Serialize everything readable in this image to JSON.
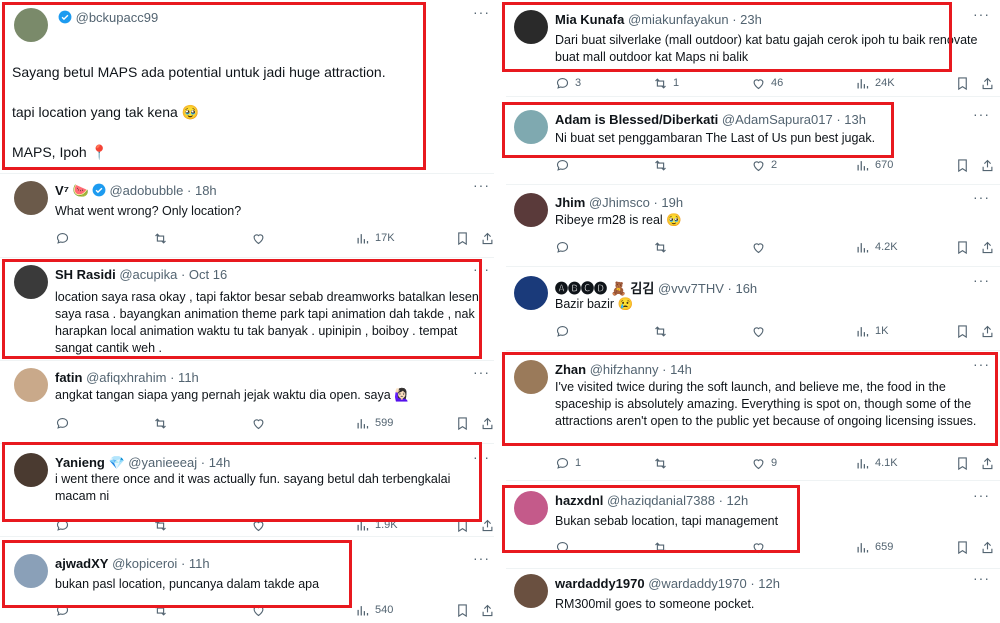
{
  "left": [
    {
      "name": "",
      "verified": true,
      "handle": "@bckupacc99",
      "time": "",
      "text": "Sayang betul MAPS ada potential untuk jadi huge attraction.\n\ntapi location yang tak kena 🥹\n\nMAPS, Ipoh 📍",
      "stats": {
        "reply": "",
        "retweet": "",
        "like": "",
        "views": ""
      },
      "avatar": "#7a8a6a",
      "actions": false
    },
    {
      "name": "V⁷ 🍉",
      "verified": true,
      "handle": "@adobubble",
      "time": "· 18h",
      "text": "What went wrong? Only location?",
      "stats": {
        "reply": "",
        "retweet": "",
        "like": "",
        "views": "17K"
      },
      "avatar": "#6b5a4a",
      "actions": true
    },
    {
      "name": "SH Rasidi",
      "verified": false,
      "handle": "@acupika",
      "time": "· Oct 16",
      "text": "location saya rasa okay , tapi faktor besar sebab dreamworks batalkan lesen saya rasa . bayangkan animation theme park tapi animation dah takde , nak harapkan local animation waktu tu tak banyak . upinipin , boiboy . tempat sangat cantik weh .",
      "stats": {
        "reply": "",
        "retweet": "",
        "like": "",
        "views": ""
      },
      "avatar": "#3a3a3a",
      "actions": false
    },
    {
      "name": "fatin",
      "verified": false,
      "handle": "@afiqxhrahim",
      "time": "· 11h",
      "text": "angkat tangan siapa yang pernah jejak waktu dia open. saya 🙋🏻‍♀️",
      "stats": {
        "reply": "",
        "retweet": "",
        "like": "",
        "views": "599"
      },
      "avatar": "#c9a98a",
      "actions": true
    },
    {
      "name": "Yanieng 💎",
      "verified": false,
      "handle": "@yanieeeaj",
      "time": "· 14h",
      "text": "i went there once and it was actually fun. sayang betul dah terbengkalai macam ni",
      "stats": {
        "reply": "",
        "retweet": "",
        "like": "",
        "views": "1.9K"
      },
      "avatar": "#4a3a30",
      "actions": true
    },
    {
      "name": "ajwadXY",
      "verified": false,
      "handle": "@kopiceroi",
      "time": "· 11h",
      "text": "bukan pasl location, puncanya dalam takde apa",
      "stats": {
        "reply": "",
        "retweet": "",
        "like": "",
        "views": "540"
      },
      "avatar": "#8aa0b8",
      "actions": true
    }
  ],
  "right": [
    {
      "name": "Mia Kunafa",
      "verified": false,
      "handle": "@miakunfayakun",
      "time": "· 23h",
      "text": "Dari buat silverlake (mall outdoor) kat batu gajah cerok ipoh tu baik renovate buat mall outdoor kat Maps ni balik",
      "stats": {
        "reply": "3",
        "retweet": "1",
        "like": "46",
        "views": "24K"
      },
      "avatar": "#2a2a2a",
      "actions": true
    },
    {
      "name": "Adam is Blessed/Diberkati",
      "verified": false,
      "handle": "@AdamSapura017",
      "time": "· 13h",
      "text": "Ni buat set penggambaran The Last of Us pun best jugak.",
      "stats": {
        "reply": "",
        "retweet": "",
        "like": "2",
        "views": "670"
      },
      "avatar": "#7fa9b0",
      "actions": true
    },
    {
      "name": "Jhim",
      "verified": false,
      "handle": "@Jhimsco",
      "time": "· 19h",
      "text": "Ribeye rm28 is real 🥹",
      "stats": {
        "reply": "",
        "retweet": "",
        "like": "",
        "views": "4.2K"
      },
      "avatar": "#5a3a3a",
      "actions": true
    },
    {
      "name": "🅐🅑🅒🅓 🧸 김김",
      "verified": false,
      "handle": "@vvv7THV",
      "time": "· 16h",
      "text": "Bazir bazir 😢",
      "stats": {
        "reply": "",
        "retweet": "",
        "like": "",
        "views": "1K"
      },
      "avatar": "#1a3a7a",
      "actions": true
    },
    {
      "name": "Zhan",
      "verified": false,
      "handle": "@hifzhanny",
      "time": "· 14h",
      "text": "I've visited twice during the soft launch, and believe me, the food in the spaceship is absolutely amazing. Everything is spot on, though some of the attractions aren't open to the public yet because of ongoing licensing issues.",
      "stats": {
        "reply": "1",
        "retweet": "",
        "like": "9",
        "views": "4.1K"
      },
      "avatar": "#9a7a5a",
      "actions": true
    },
    {
      "name": "hazxdnl",
      "verified": false,
      "handle": "@haziqdanial7388",
      "time": "· 12h",
      "text": "Bukan sebab location, tapi management",
      "stats": {
        "reply": "",
        "retweet": "",
        "like": "",
        "views": "659"
      },
      "avatar": "#c45a8a",
      "actions": true
    },
    {
      "name": "wardaddy1970",
      "verified": false,
      "handle": "@wardaddy1970",
      "time": "· 12h",
      "text": "RM300mil goes to someone pocket.",
      "stats": {
        "reply": "",
        "retweet": "",
        "like": "",
        "views": ""
      },
      "avatar": "#6a5040",
      "actions": false
    }
  ]
}
